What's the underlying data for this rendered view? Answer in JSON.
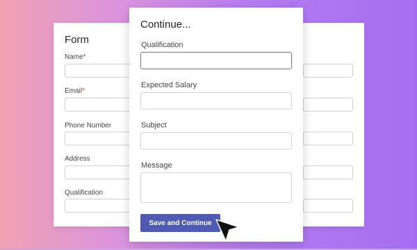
{
  "back_form": {
    "title": "Form",
    "fields": [
      {
        "label": "Name",
        "required": "*"
      },
      {
        "label": "Email",
        "required": "*"
      },
      {
        "label": "Phone Number",
        "required": ""
      },
      {
        "label": "Address",
        "required": ""
      },
      {
        "label": "Qualification",
        "required": ""
      }
    ]
  },
  "front_form": {
    "title": "Continue...",
    "fields": [
      {
        "label": "Qualification",
        "value": ""
      },
      {
        "label": "Expected Salary",
        "value": ""
      },
      {
        "label": "Subject",
        "value": ""
      },
      {
        "label": "Message",
        "value": ""
      }
    ],
    "submit_label": "Save and Continue"
  },
  "colors": {
    "button": "#4f5bb3",
    "required_marker": "#c0392b"
  },
  "icons": {
    "cursor": "mouse-pointer-icon"
  }
}
